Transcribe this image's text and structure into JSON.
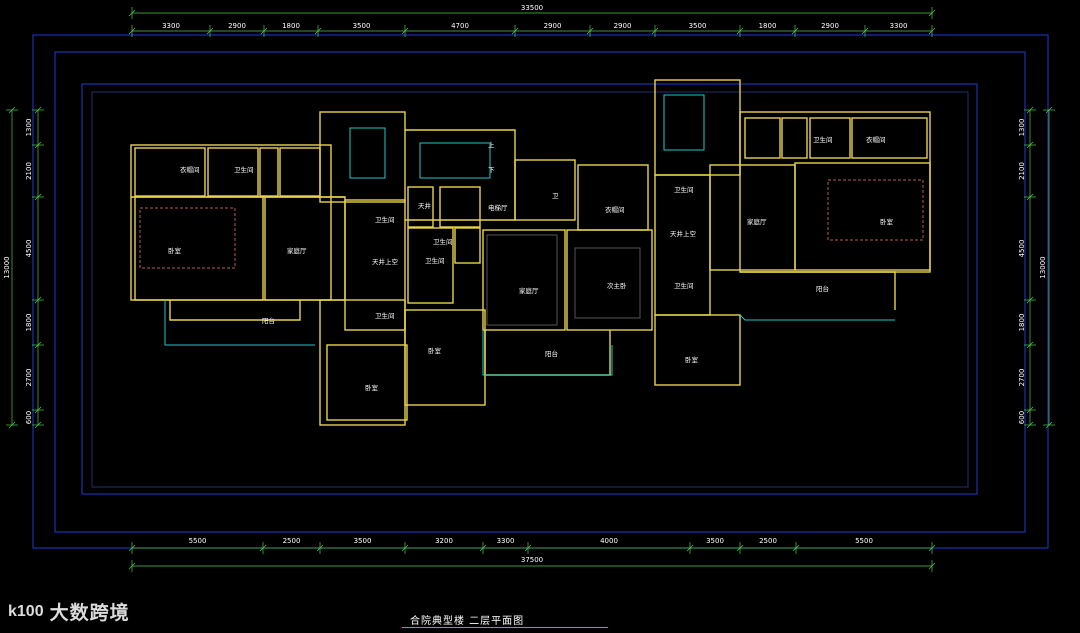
{
  "drawing_title": "合院典型楼 二层平面图",
  "watermark": {
    "mark": "k100",
    "text": "大数跨境"
  },
  "dimensions": {
    "top_total": "33500",
    "top_segments": [
      "3300",
      "2900",
      "1800",
      "3500",
      "4700",
      "2900",
      "2900",
      "3500",
      "1800",
      "2900",
      "3300"
    ],
    "bottom_segments": [
      "5500",
      "2500",
      "3500",
      "3200",
      "3300",
      "4000",
      "3500",
      "2500",
      "5500"
    ],
    "bottom_total": "37500",
    "left_segments": [
      "1300",
      "2100",
      "4500",
      "1800",
      "2700",
      "600"
    ],
    "left_total": "13000",
    "right_segments": [
      "1300",
      "2100",
      "4500",
      "1800",
      "2700",
      "600"
    ],
    "right_total": "13000"
  },
  "rooms": {
    "cloak_l": "衣帽间",
    "bath_l1": "卫生间",
    "bed_l": "卧室",
    "family_l": "家庭厅",
    "light_well_l": "天井上空",
    "bath_l2": "卫生间",
    "bath_l3": "卫生间",
    "balcony_l": "阳台",
    "bed_l2": "卧室",
    "bed_l3": "卧室",
    "bath_l4": "卫生间",
    "light_well_m": "天井",
    "elevator": "电梯厅",
    "bath_m": "卫生间",
    "family_m": "家庭厅",
    "wei": "卫",
    "cloak_m": "衣帽间",
    "master_bed": "次主卧",
    "balcony_m": "阳台",
    "bed_m2": "卧室",
    "bath_r1": "卫生间",
    "light_well_r": "天井上空",
    "bath_r2": "卫生间",
    "family_r": "家庭厅",
    "bed_r": "卧室",
    "bath_r3": "卫生间",
    "cloak_r": "衣帽间",
    "balcony_r": "阳台",
    "bed_r2": "卧室",
    "stair_label": "上",
    "stair_label2": "下"
  },
  "colors": {
    "background": "#000000",
    "wall": "#e8d44a",
    "outline_blue": "#1d3bd6",
    "dim_green": "#52c94a",
    "white": "#ffffff",
    "cyan": "#20c8c8"
  }
}
